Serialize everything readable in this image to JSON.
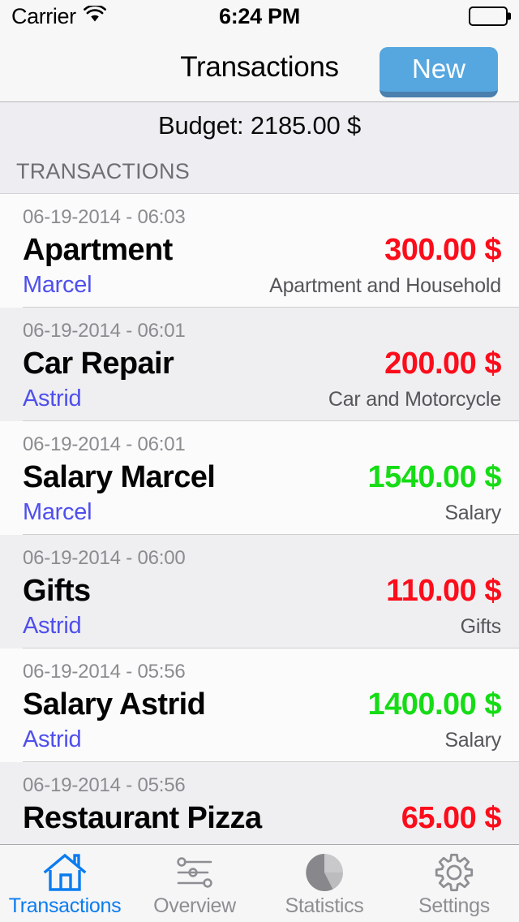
{
  "status_bar": {
    "carrier": "Carrier",
    "wifi_icon": "wifi-icon",
    "time": "6:24 PM",
    "battery_icon": "battery-full-icon"
  },
  "nav_bar": {
    "title": "Transactions",
    "new_label": "New"
  },
  "budget": {
    "text": "Budget: 2185.00 $"
  },
  "section": {
    "header": "TRANSACTIONS"
  },
  "colors": {
    "expense": "#fc0d1b",
    "income": "#16dc16",
    "person": "#4f4fee",
    "accent": "#0a7cf0",
    "button": "#56a7e0"
  },
  "transactions": [
    {
      "date": "06-19-2014 - 06:03",
      "title": "Apartment",
      "amount": "300.00 $",
      "type": "expense",
      "person": "Marcel",
      "category": "Apartment and Household"
    },
    {
      "date": "06-19-2014 - 06:01",
      "title": "Car Repair",
      "amount": "200.00 $",
      "type": "expense",
      "person": "Astrid",
      "category": "Car and Motorcycle"
    },
    {
      "date": "06-19-2014 - 06:01",
      "title": "Salary Marcel",
      "amount": "1540.00 $",
      "type": "income",
      "person": "Marcel",
      "category": "Salary"
    },
    {
      "date": "06-19-2014 - 06:00",
      "title": "Gifts",
      "amount": "110.00 $",
      "type": "expense",
      "person": "Astrid",
      "category": "Gifts"
    },
    {
      "date": "06-19-2014 - 05:56",
      "title": "Salary Astrid",
      "amount": "1400.00 $",
      "type": "income",
      "person": "Astrid",
      "category": "Salary"
    },
    {
      "date": "06-19-2014 - 05:56",
      "title": "Restaurant Pizza",
      "amount": "65.00 $",
      "type": "expense",
      "person": "",
      "category": ""
    }
  ],
  "tabs": [
    {
      "label": "Transactions",
      "icon": "house-icon",
      "active": true
    },
    {
      "label": "Overview",
      "icon": "sliders-icon",
      "active": false
    },
    {
      "label": "Statistics",
      "icon": "pie-chart-icon",
      "active": false
    },
    {
      "label": "Settings",
      "icon": "gear-icon",
      "active": false
    }
  ]
}
